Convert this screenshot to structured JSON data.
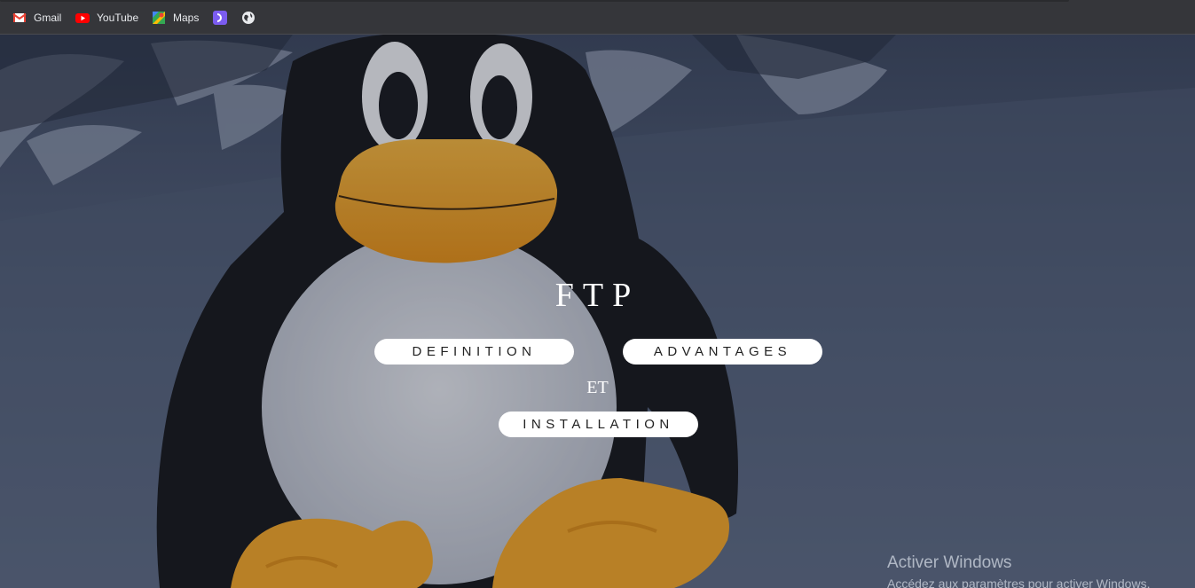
{
  "bookmarks": {
    "items": [
      {
        "label": "Gmail",
        "icon": "gmail-icon"
      },
      {
        "label": "YouTube",
        "icon": "youtube-icon"
      },
      {
        "label": "Maps",
        "icon": "maps-icon"
      },
      {
        "label": "",
        "icon": "extension-icon"
      },
      {
        "label": "",
        "icon": "globe-icon"
      }
    ]
  },
  "main": {
    "title": "FTP",
    "buttons": {
      "definition": "DEFINITION",
      "advantages": "ADVANTAGES",
      "installation": "INSTALLATION"
    },
    "connector": "ET"
  },
  "watermark": {
    "heading": "Activer Windows",
    "subtext": "Accédez aux paramètres pour activer Windows."
  },
  "colors": {
    "toolbar": "#35363a",
    "button_bg": "#ffffff",
    "title_text": "#ffffff",
    "penguin_body": "#141417",
    "penguin_beak": "#f5a623",
    "snow": "#5d6a85"
  }
}
